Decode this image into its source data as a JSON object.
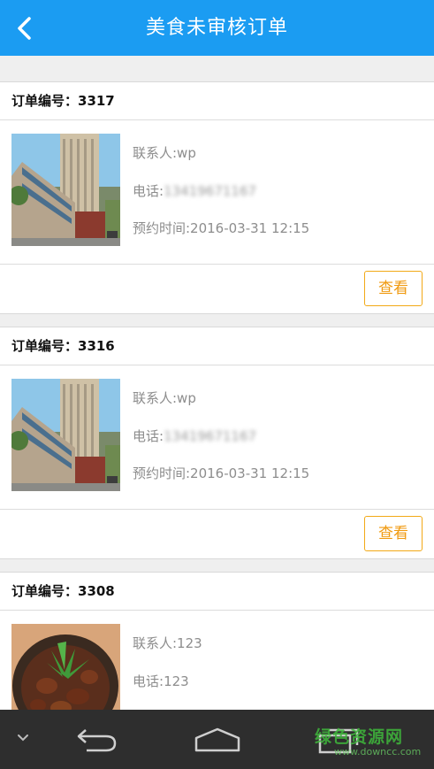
{
  "header": {
    "title": "美食未审核订单",
    "back_icon": "chevron-left-icon"
  },
  "orders": [
    {
      "order_label": "订单编号：3317",
      "contact": "联系人:wp",
      "phone_label": "电话:",
      "phone_value": "13419671167",
      "time": "预约时间:2016-03-31 12:15",
      "view_label": "查看"
    },
    {
      "order_label": "订单编号：3316",
      "contact": "联系人:wp",
      "phone_label": "电话:",
      "phone_value": "13419671167",
      "time": "预约时间:2016-03-31 12:15",
      "view_label": "查看"
    },
    {
      "order_label": "订单编号：3308",
      "contact": "联系人:123",
      "phone_label": "电话:",
      "phone_value": "123"
    }
  ],
  "navbar": {
    "icons": [
      "chevron-down-icon",
      "back-icon",
      "home-icon",
      "recent-apps-icon"
    ]
  },
  "watermark": {
    "text": "绿色资源网",
    "url": "www.downcc.com"
  },
  "colors": {
    "accent": "#1b9cf2",
    "button_border": "#f2a916",
    "button_text": "#f09a10"
  }
}
